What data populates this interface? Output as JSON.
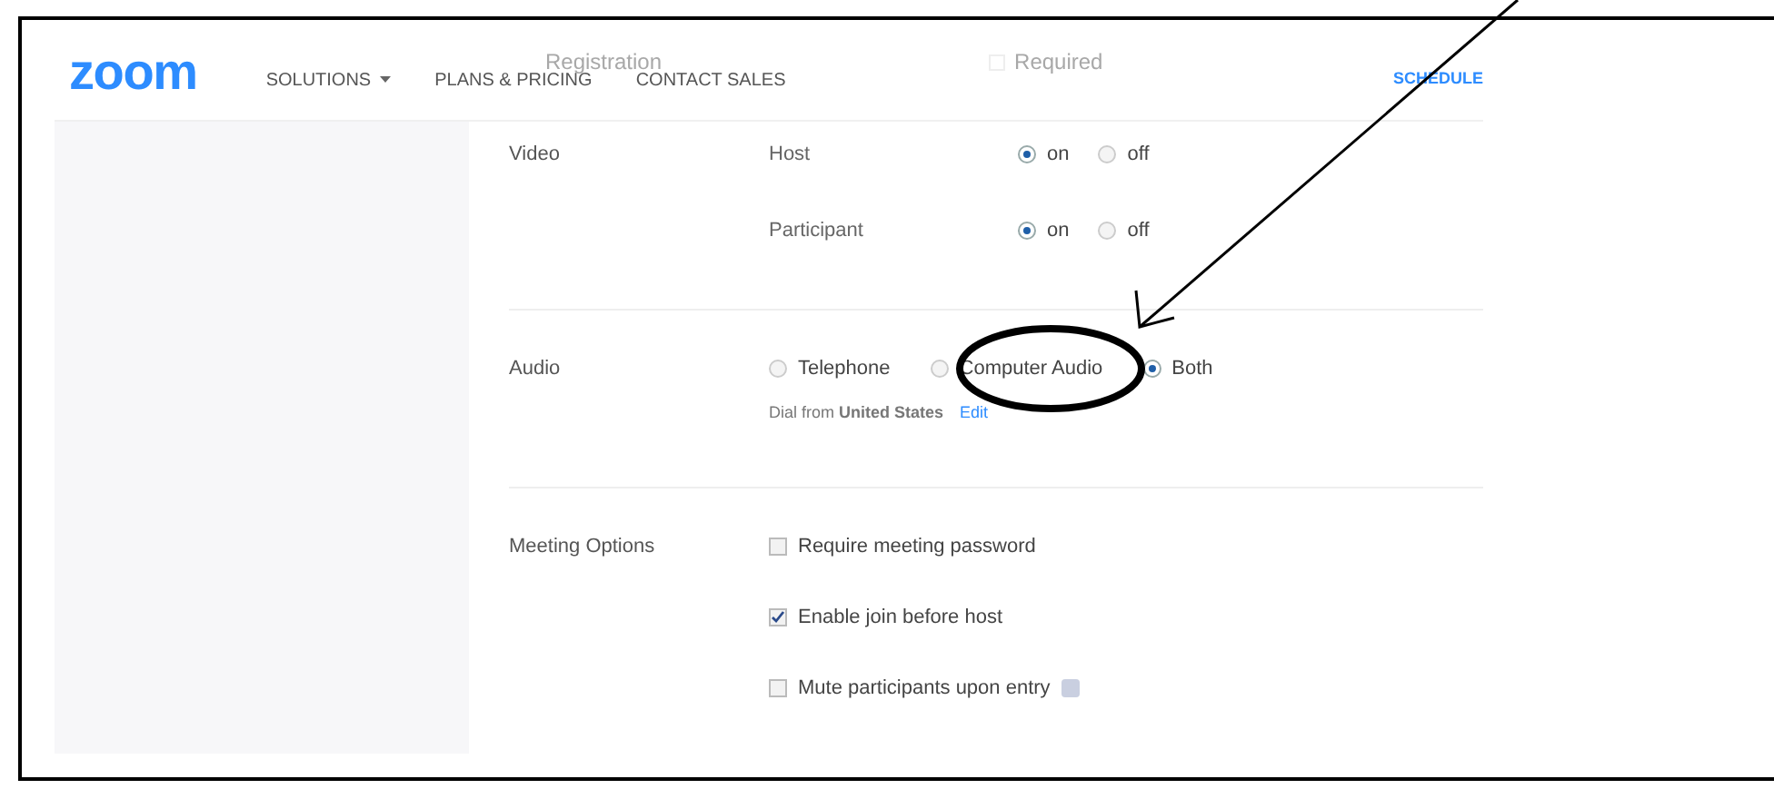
{
  "header": {
    "logo": "zoom",
    "links": [
      {
        "label": "SOLUTIONS",
        "dropdown": true
      },
      {
        "label": "PLANS & PRICING",
        "dropdown": false
      },
      {
        "label": "CONTACT SALES",
        "dropdown": false
      }
    ],
    "action": "SCHEDULE"
  },
  "behind_header": {
    "label": "Registration",
    "option": "Required",
    "checked": false
  },
  "video": {
    "label": "Video",
    "rows": [
      {
        "label": "Host",
        "options": [
          {
            "label": "on",
            "selected": true
          },
          {
            "label": "off",
            "selected": false
          }
        ]
      },
      {
        "label": "Participant",
        "options": [
          {
            "label": "on",
            "selected": true
          },
          {
            "label": "off",
            "selected": false
          }
        ]
      }
    ]
  },
  "audio": {
    "label": "Audio",
    "options": [
      {
        "label": "Telephone",
        "selected": false
      },
      {
        "label": "Computer Audio",
        "selected": false
      },
      {
        "label": "Both",
        "selected": true
      }
    ],
    "dial": "Dial from **United States**",
    "edit": "Edit"
  },
  "meeting_options": {
    "label": "Meeting Options",
    "items": [
      {
        "label": "Require meeting password",
        "checked": false,
        "info": false
      },
      {
        "label": "Enable join before host",
        "checked": true,
        "info": false
      },
      {
        "label": "Mute participants upon entry",
        "checked": false,
        "info": true
      }
    ]
  }
}
